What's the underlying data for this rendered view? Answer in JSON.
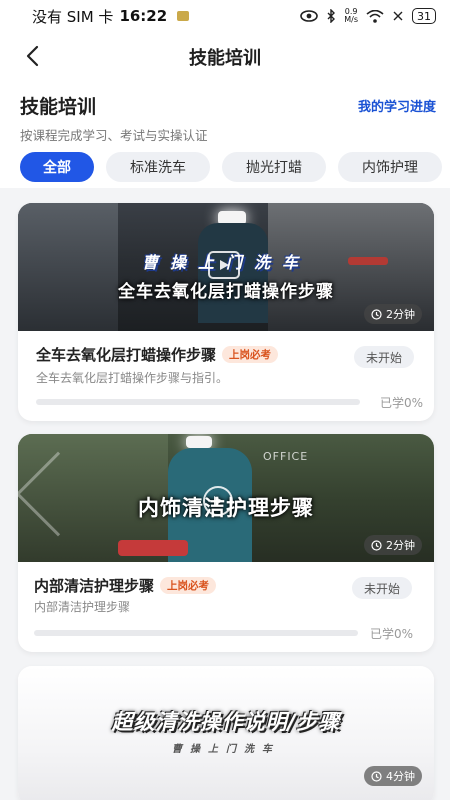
{
  "status_bar": {
    "carrier": "没有 SIM 卡",
    "time": "16:22",
    "net_speed": "0.9",
    "net_unit": "M/s",
    "battery": "31"
  },
  "nav": {
    "title": "技能培训"
  },
  "header": {
    "title": "技能培训",
    "subtitle": "按课程完成学习、考试与实操认证",
    "progress_link": "我的学习进度"
  },
  "tabs": [
    {
      "label": "全部",
      "active": true
    },
    {
      "label": "标准洗车",
      "active": false
    },
    {
      "label": "抛光打蜡",
      "active": false
    },
    {
      "label": "内饰护理",
      "active": false
    }
  ],
  "courses": [
    {
      "thumb_brand": "曹操上门洗车",
      "thumb_title": "全车去氧化层打蜡操作步骤",
      "duration": "2分钟",
      "title": "全车去氧化层打蜡操作步骤",
      "tag": "上岗必考",
      "description": "全车去氧化层打蜡操作步骤与指引。",
      "status": "未开始",
      "progress_label": "已学0%",
      "progress": 0
    },
    {
      "thumb_title": "内饰清洁护理步骤",
      "thumb_sign": "OFFICE",
      "duration": "2分钟",
      "title": "内部清洁护理步骤",
      "tag": "上岗必考",
      "description": "内部清洁护理步骤",
      "status": "未开始",
      "progress_label": "已学0%",
      "progress": 0
    },
    {
      "thumb_title": "超级清洗操作说明/步骤",
      "thumb_brand": "曹操上门洗车",
      "duration": "4分钟"
    }
  ],
  "colors": {
    "accent": "#2157e6",
    "tag_text": "#d9531e",
    "tag_bg": "#fde7dc"
  }
}
